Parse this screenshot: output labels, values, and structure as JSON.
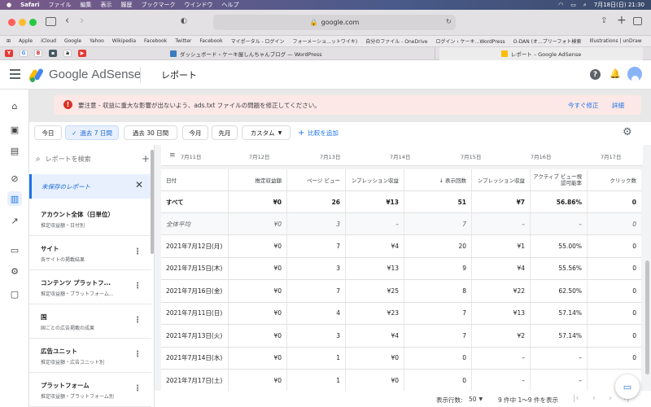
{
  "menubar": {
    "app": "Safari",
    "menus": [
      "ファイル",
      "編集",
      "表示",
      "履歴",
      "ブックマーク",
      "ウインドウ",
      "ヘルプ"
    ],
    "clock": "7月18日(日)  21:30"
  },
  "browser": {
    "address": "google.com",
    "favorites": [
      "Apple",
      "iCloud",
      "Google",
      "Yahoo",
      "Wikipedia",
      "Facebook",
      "Twitter",
      "Facebook",
      "マイポータル - ログイン",
      "フォーメーショ...ットワイキ)",
      "自分のファイル - OneDrive",
      "ログイン › ケーキ...WordPress",
      "O-DAN (オ...プリーフォト検索",
      "Illustrations | unDraw"
    ],
    "tabs": [
      "ダッシュボード ‹ ケーキ屋しんちゃんブログ — WordPress",
      "レポート – Google AdSense"
    ]
  },
  "header": {
    "product_google": "Google",
    "product_name": "AdSense",
    "page_title": "レポート"
  },
  "banner": {
    "message": "要注意 - 収益に重大な影響が出ないよう、ads.txt ファイルの問題を修正してください。",
    "fix_label": "今すぐ修正",
    "details_label": "詳細"
  },
  "chips": [
    "今日",
    "過去 7 日間",
    "過去 30 日間",
    "今月",
    "先月",
    "カスタム"
  ],
  "compare_label": "比較を追加",
  "panel": {
    "search_placeholder": "レポートを検索",
    "unsaved": "未保存のレポート",
    "reports": [
      {
        "title": "アカウント全体（日単位）",
        "sub": "推定収益額・日付別"
      },
      {
        "title": "サイト",
        "sub": "各サイトの掲載結果"
      },
      {
        "title": "コンテンツ プラットフ...",
        "sub": "推定収益額・プラットフォーム..."
      },
      {
        "title": "国",
        "sub": "国ごとの広告掲載の成果"
      },
      {
        "title": "広告ユニット",
        "sub": "推定収益額・広告ユニット別"
      },
      {
        "title": "プラットフォーム",
        "sub": "推定収益額・プラットフォーム別"
      }
    ]
  },
  "timeline_dates": [
    "7月11日",
    "7月12日",
    "7月13日",
    "7月14日",
    "7月15日",
    "7月16日",
    "7月17日"
  ],
  "table": {
    "headers": [
      "日付",
      "推定収益額",
      "ページ ビュー",
      "ンプレッション収益",
      "↓ 表示回数",
      "ンプレッション収益",
      "アクティブ ビュー視認可能率",
      "クリック数"
    ],
    "total": [
      "すべて",
      "¥0",
      "26",
      "¥13",
      "51",
      "¥7",
      "56.86%",
      "0"
    ],
    "average": [
      "全体平均",
      "¥0",
      "3",
      "–",
      "7",
      "–",
      "–",
      "0"
    ],
    "rows": [
      [
        "2021年7月12日(月)",
        "¥0",
        "7",
        "¥4",
        "20",
        "¥1",
        "55.00%",
        "0"
      ],
      [
        "2021年7月15日(木)",
        "¥0",
        "3",
        "¥13",
        "9",
        "¥4",
        "55.56%",
        "0"
      ],
      [
        "2021年7月16日(金)",
        "¥0",
        "7",
        "¥25",
        "8",
        "¥22",
        "62.50%",
        "0"
      ],
      [
        "2021年7月11日(日)",
        "¥0",
        "4",
        "¥23",
        "7",
        "¥13",
        "57.14%",
        "0"
      ],
      [
        "2021年7月13日(火)",
        "¥0",
        "3",
        "¥4",
        "7",
        "¥2",
        "57.14%",
        "0"
      ],
      [
        "2021年7月14日(水)",
        "¥0",
        "1",
        "¥0",
        "0",
        "–",
        "–",
        "0"
      ],
      [
        "2021年7月17日(土)",
        "¥0",
        "1",
        "¥0",
        "0",
        "–",
        "–",
        "0"
      ]
    ]
  },
  "footer": {
    "rows_label": "表示行数:",
    "rows_value": "50",
    "range": "9 件中 1〜9 件を表示"
  }
}
